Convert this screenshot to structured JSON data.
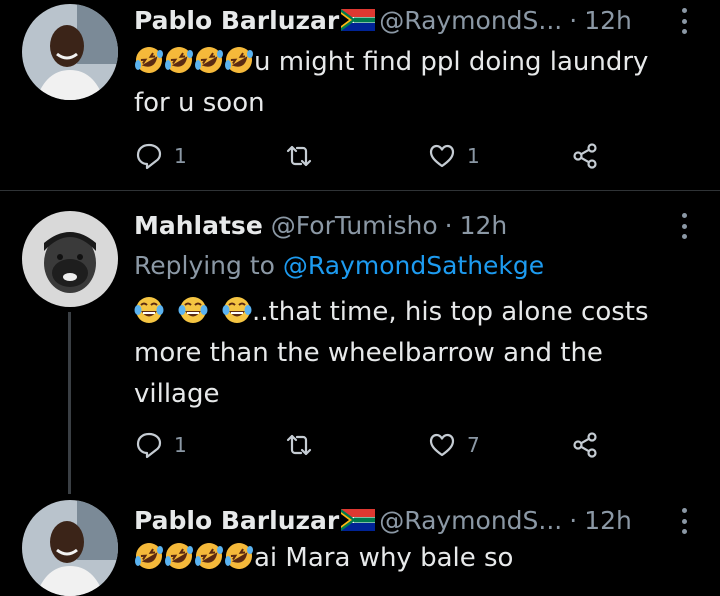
{
  "tweets": [
    {
      "name": "Pablo Barluzar",
      "handle": "@RaymondS...",
      "dot": "·",
      "time": "12h",
      "text_lines": [
        "u might find ppl doing laundry",
        "for u soon"
      ],
      "emoji_prefix": [
        "rofl-emoji",
        "rofl-emoji",
        "rofl-emoji",
        "rofl-emoji"
      ],
      "reply_count": "1",
      "retweet_count": "",
      "like_count": "1"
    },
    {
      "name": "Mahlatse",
      "handle": "@ForTumisho",
      "dot": "·",
      "time": "12h",
      "replying_label": "Replying to",
      "replying_to": "@RaymondSathekge",
      "text_lines": [
        "..that time, his top alone costs",
        "more than the wheelbarrow and the",
        "village"
      ],
      "emoji_prefix": [
        "tears-of-joy-emoji",
        "tears-of-joy-emoji",
        "tears-of-joy-emoji"
      ],
      "reply_count": "1",
      "retweet_count": "",
      "like_count": "7"
    },
    {
      "name": "Pablo Barluzar",
      "handle": "@RaymondS...",
      "dot": "·",
      "time": "12h",
      "text_lines": [
        "ai Mara why bale so"
      ],
      "emoji_prefix": [
        "rofl-emoji",
        "rofl-emoji",
        "rofl-emoji",
        "rofl-emoji"
      ]
    }
  ],
  "icons": [
    "reply-icon",
    "retweet-icon",
    "like-icon",
    "share-icon",
    "more-icon",
    "south-africa-flag-icon"
  ],
  "colors": {
    "background": "#000000",
    "text": "#e7e9ea",
    "muted": "#8b98a5",
    "link": "#1d9bf0"
  }
}
